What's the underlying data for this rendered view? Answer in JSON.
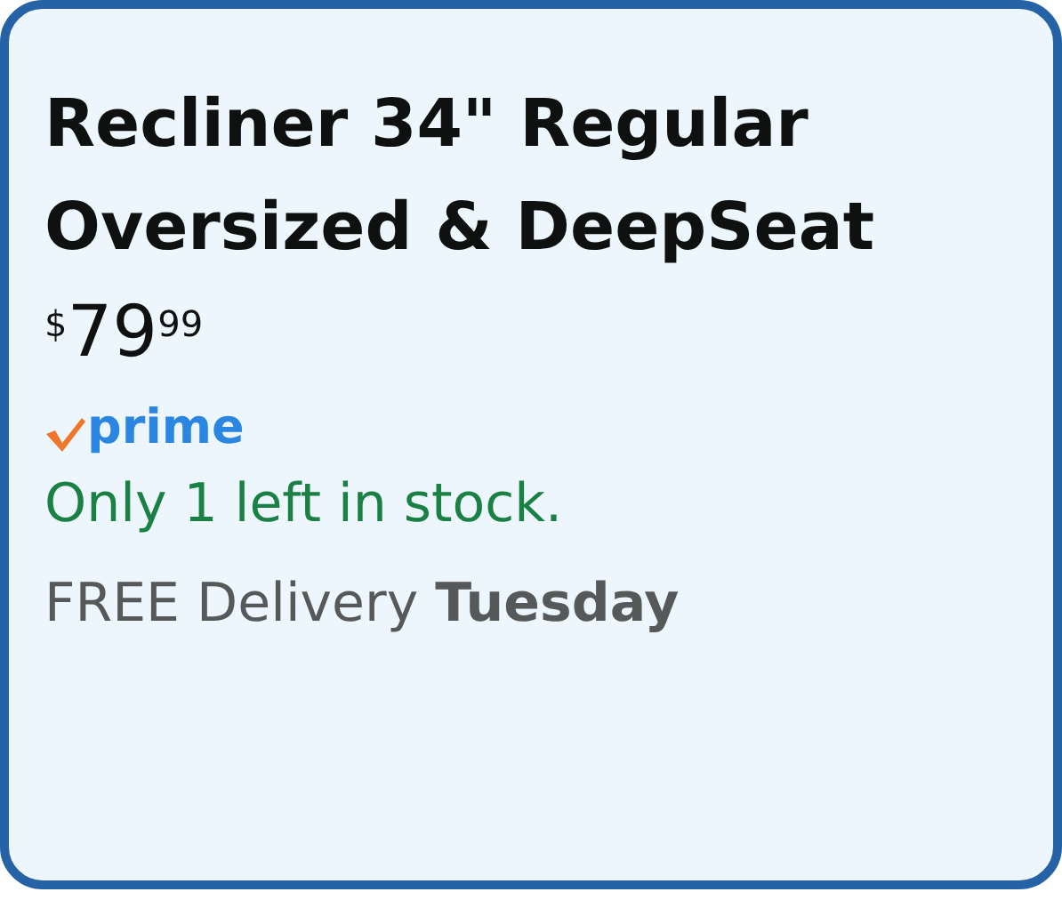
{
  "product": {
    "title": "Recliner 34\" Regular Oversized & DeepSeat",
    "price": {
      "currency": "$",
      "whole": "79",
      "fraction": "99"
    },
    "badge": {
      "kind": "prime",
      "label": "prime"
    },
    "stock": "Only 1 left in stock.",
    "delivery": "FREE Delivery **Tuesday**"
  }
}
